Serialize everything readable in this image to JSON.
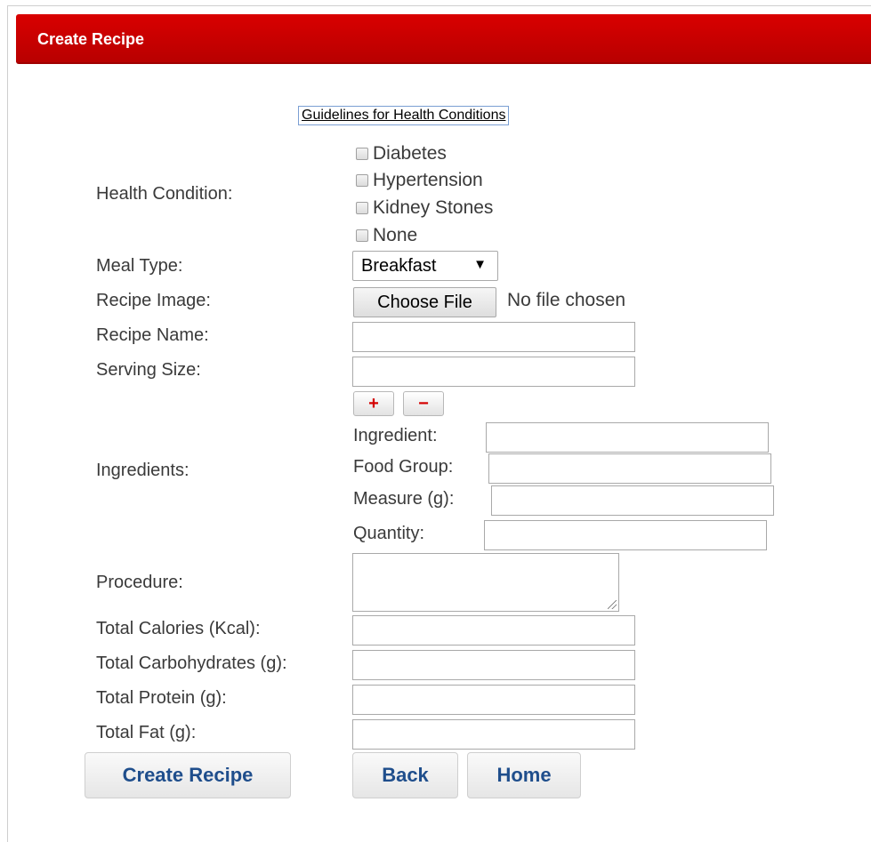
{
  "header": {
    "title": "Create Recipe"
  },
  "guidelines_link": "Guidelines for Health Conditions",
  "health_condition": {
    "label": "Health Condition:",
    "options": [
      "Diabetes",
      "Hypertension",
      "Kidney Stones",
      "None"
    ]
  },
  "meal_type": {
    "label": "Meal Type:",
    "selected": "Breakfast"
  },
  "recipe_image": {
    "label": "Recipe Image:",
    "button": "Choose File",
    "status": "No file chosen"
  },
  "recipe_name": {
    "label": "Recipe Name:",
    "value": ""
  },
  "serving_size": {
    "label": "Serving Size:",
    "value": ""
  },
  "ingredients": {
    "label": "Ingredients:",
    "add": "+",
    "remove": "−",
    "fields": {
      "ingredient": "Ingredient:",
      "food_group": "Food Group:",
      "measure": "Measure (g):",
      "quantity": "Quantity:"
    }
  },
  "procedure": {
    "label": "Procedure:"
  },
  "totals": {
    "calories": "Total Calories (Kcal):",
    "carbohydrates": "Total Carbohydrates (g):",
    "protein": "Total Protein (g):",
    "fat": "Total Fat (g):"
  },
  "buttons": {
    "create": "Create Recipe",
    "back": "Back",
    "home": "Home"
  },
  "colors": {
    "header": "#c40000",
    "button_text": "#1f4e8c",
    "pm_icon": "#d40000"
  }
}
